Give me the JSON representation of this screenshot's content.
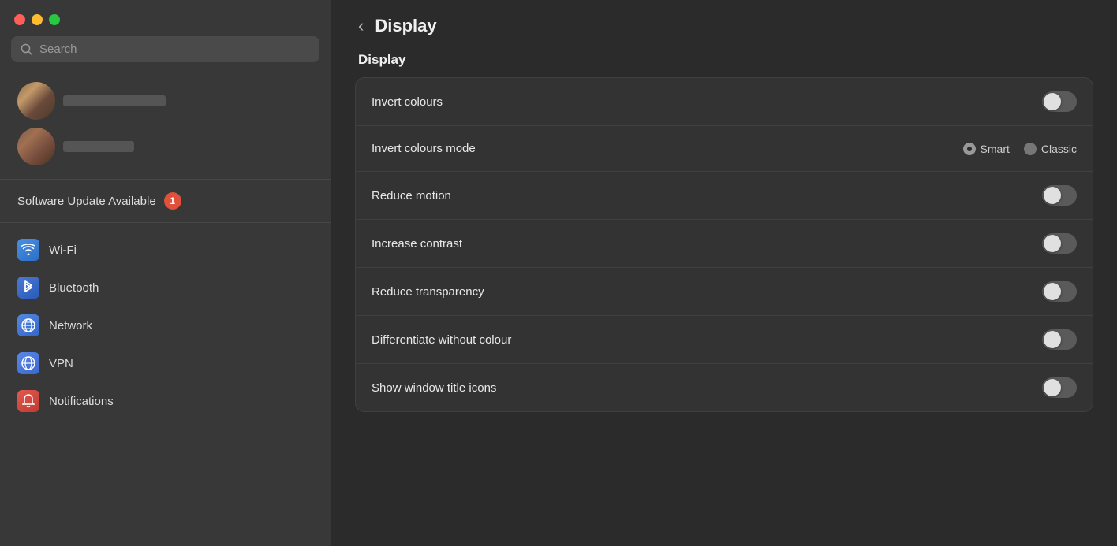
{
  "window": {
    "traffic_lights": {
      "close_color": "#ff5f57",
      "minimize_color": "#febc2e",
      "maximize_color": "#28c840"
    }
  },
  "sidebar": {
    "search_placeholder": "Search",
    "software_update": {
      "label": "Software Update Available",
      "badge": "1"
    },
    "items": [
      {
        "id": "wifi",
        "label": "Wi-Fi",
        "icon_class": "icon-wifi"
      },
      {
        "id": "bluetooth",
        "label": "Bluetooth",
        "icon_class": "icon-bluetooth"
      },
      {
        "id": "network",
        "label": "Network",
        "icon_class": "icon-network"
      },
      {
        "id": "vpn",
        "label": "VPN",
        "icon_class": "icon-vpn"
      },
      {
        "id": "notifications",
        "label": "Notifications",
        "icon_class": "icon-notifications"
      }
    ]
  },
  "main": {
    "back_button_label": "‹",
    "page_title": "Display",
    "section_title": "Display",
    "settings": [
      {
        "id": "invert-colours",
        "label": "Invert colours",
        "control": "toggle",
        "value": false
      },
      {
        "id": "invert-colours-mode",
        "label": "Invert colours mode",
        "control": "radio",
        "options": [
          {
            "id": "smart",
            "label": "Smart",
            "selected": true
          },
          {
            "id": "classic",
            "label": "Classic",
            "selected": false
          }
        ]
      },
      {
        "id": "reduce-motion",
        "label": "Reduce motion",
        "control": "toggle",
        "value": false
      },
      {
        "id": "increase-contrast",
        "label": "Increase contrast",
        "control": "toggle",
        "value": false
      },
      {
        "id": "reduce-transparency",
        "label": "Reduce transparency",
        "control": "toggle",
        "value": false
      },
      {
        "id": "differentiate-without-colour",
        "label": "Differentiate without colour",
        "control": "toggle",
        "value": false
      },
      {
        "id": "show-window-title-icons",
        "label": "Show window title icons",
        "control": "toggle",
        "value": false
      }
    ]
  }
}
